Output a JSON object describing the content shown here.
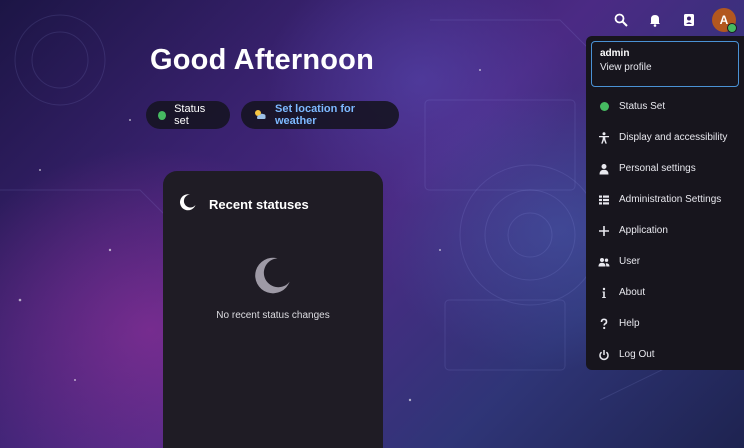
{
  "greeting": "Good Afternoon",
  "status_pill": {
    "label": "Status set",
    "dot_color": "#46ba61"
  },
  "weather_pill": {
    "label": "Set location for weather",
    "color": "#7db9ff"
  },
  "recent_statuses": {
    "title": "Recent statuses",
    "empty_text": "No recent status changes"
  },
  "header": {
    "icons": [
      "search-icon",
      "notifications-icon",
      "contacts-icon"
    ],
    "avatar_letter": "A",
    "avatar_color": "#b2571f"
  },
  "user_menu": {
    "username": "admin",
    "view_profile": "View profile",
    "items": [
      {
        "label": "Status Set",
        "icon": "status-dot-icon"
      },
      {
        "label": "Display and accessibility",
        "icon": "accessibility-icon"
      },
      {
        "label": "Personal settings",
        "icon": "person-icon"
      },
      {
        "label": "Administration Settings",
        "icon": "admin-list-icon"
      },
      {
        "label": "Application",
        "icon": "plus-icon"
      },
      {
        "label": "User",
        "icon": "users-icon"
      },
      {
        "label": "About",
        "icon": "info-icon"
      },
      {
        "label": "Help",
        "icon": "help-icon"
      },
      {
        "label": "Log Out",
        "icon": "power-icon"
      }
    ]
  }
}
